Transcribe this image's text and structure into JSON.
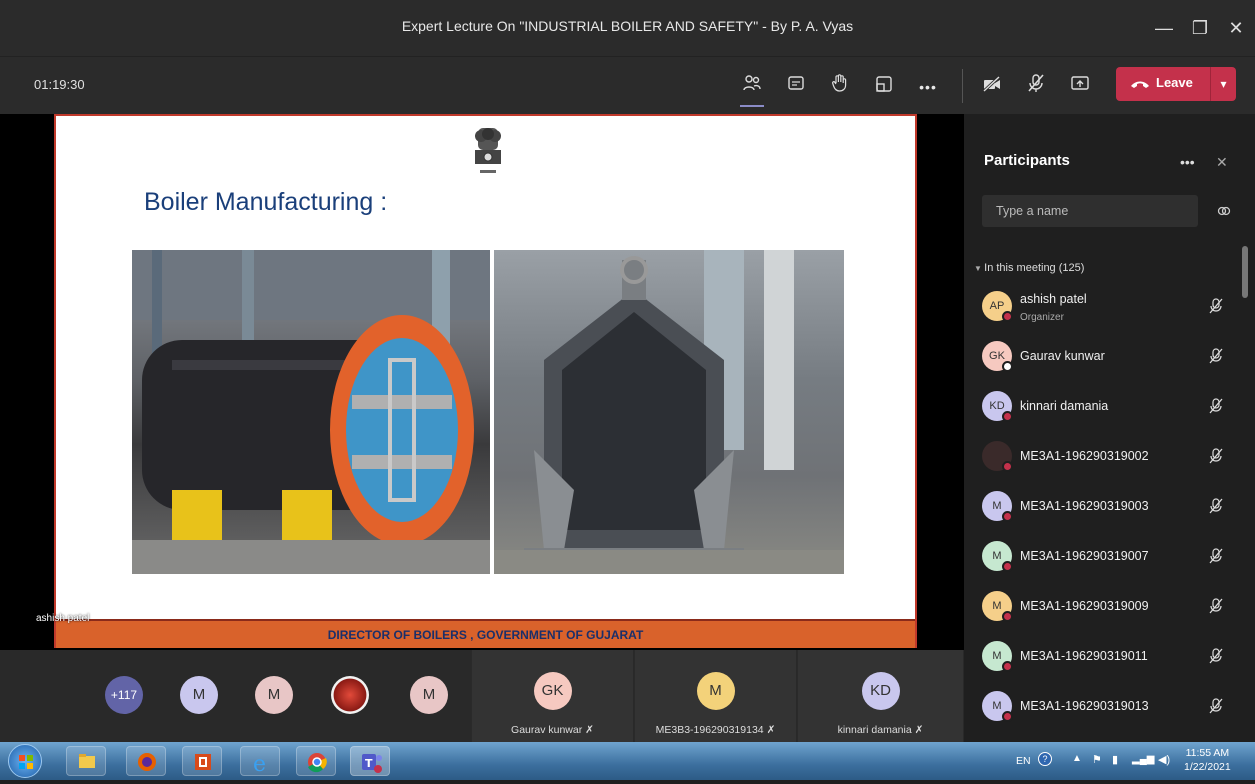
{
  "window": {
    "title": "Expert Lecture On \"INDUSTRIAL BOILER AND SAFETY\" - By P. A. Vyas",
    "minimize": "—",
    "maximize": "❐",
    "close": "✕"
  },
  "toolbar": {
    "timer": "01:19:30",
    "leave_label": "Leave"
  },
  "slide": {
    "title": "Boiler Manufacturing :",
    "footer": "DIRECTOR OF BOILERS , GOVERNMENT OF GUJARAT",
    "speaker_label": "ashish patel"
  },
  "strip": {
    "overflow_count": "+117",
    "avatars": [
      "M",
      "M",
      "M"
    ],
    "tiles": [
      {
        "initials": "GK",
        "name": "Gaurav kunwar",
        "color": "#f6c9c0"
      },
      {
        "initials": "M",
        "name": "ME3B3-196290319134",
        "color": "#f3d27a"
      },
      {
        "initials": "KD",
        "name": "kinnari damania",
        "color": "#c9c7ee"
      }
    ]
  },
  "participants": {
    "title": "Participants",
    "search_placeholder": "Type a name",
    "section": "In this meeting (125)",
    "people": [
      {
        "initials": "AP",
        "name": "ashish patel",
        "role": "Organizer",
        "color": "#f5cf8a"
      },
      {
        "initials": "GK",
        "name": "Gaurav kunwar",
        "role": "",
        "color": "#f6c9c0"
      },
      {
        "initials": "KD",
        "name": "kinnari damania",
        "role": "",
        "color": "#c9c7ee"
      },
      {
        "initials": "",
        "name": "ME3A1-196290319002",
        "role": "",
        "color": "#3a2a2a"
      },
      {
        "initials": "M",
        "name": "ME3A1-196290319003",
        "role": "",
        "color": "#c9c7ee"
      },
      {
        "initials": "M",
        "name": "ME3A1-196290319007",
        "role": "",
        "color": "#c6e8d0"
      },
      {
        "initials": "M",
        "name": "ME3A1-196290319009",
        "role": "",
        "color": "#f5cf8a"
      },
      {
        "initials": "M",
        "name": "ME3A1-196290319011",
        "role": "",
        "color": "#c6e8d0"
      },
      {
        "initials": "M",
        "name": "ME3A1-196290319013",
        "role": "",
        "color": "#c9c7ee"
      }
    ]
  },
  "taskbar": {
    "lang": "EN",
    "time": "11:55 AM",
    "date": "1/22/2021"
  }
}
